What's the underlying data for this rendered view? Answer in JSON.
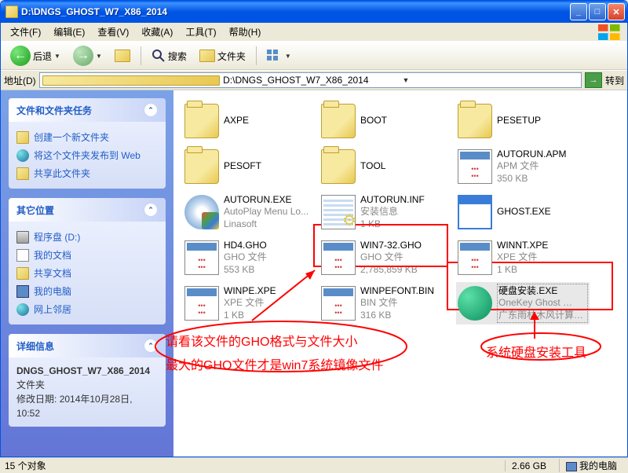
{
  "window": {
    "title": "D:\\DNGS_GHOST_W7_X86_2014"
  },
  "menubar": {
    "file": "文件(F)",
    "edit": "编辑(E)",
    "view": "查看(V)",
    "fav": "收藏(A)",
    "tools": "工具(T)",
    "help": "帮助(H)"
  },
  "toolbar": {
    "back": "后退",
    "search": "搜索",
    "folders": "文件夹"
  },
  "addressbar": {
    "label": "地址(D)",
    "path": "D:\\DNGS_GHOST_W7_X86_2014",
    "go": "转到"
  },
  "sidebar": {
    "tasks_title": "文件和文件夹任务",
    "tasks": {
      "new_folder": "创建一个新文件夹",
      "publish": "将这个文件夹发布到 Web",
      "share": "共享此文件夹"
    },
    "other_title": "其它位置",
    "other": {
      "disk": "程序盘 (D:)",
      "mydocs": "我的文档",
      "shared": "共享文档",
      "mycomp": "我的电脑",
      "network": "网上邻居"
    },
    "details_title": "详细信息",
    "details": {
      "name": "DNGS_GHOST_W7_X86_2014",
      "type": "文件夹",
      "mod_label": "修改日期:",
      "mod_value": "2014年10月28日, 10:52"
    }
  },
  "files": [
    {
      "name": "AXPE",
      "type": "",
      "size": "",
      "icon": "folder"
    },
    {
      "name": "BOOT",
      "type": "",
      "size": "",
      "icon": "folder"
    },
    {
      "name": "PESETUP",
      "type": "",
      "size": "",
      "icon": "folder"
    },
    {
      "name": "PESOFT",
      "type": "",
      "size": "",
      "icon": "folder"
    },
    {
      "name": "TOOL",
      "type": "",
      "size": "",
      "icon": "folder"
    },
    {
      "name": "AUTORUN.APM",
      "type": "APM 文件",
      "size": "350 KB",
      "icon": "doc"
    },
    {
      "name": "AUTORUN.EXE",
      "type": "AutoPlay Menu Lo...",
      "size": "Linasoft",
      "icon": "exe-cd"
    },
    {
      "name": "AUTORUN.INF",
      "type": "安装信息",
      "size": "1 KB",
      "icon": "inf"
    },
    {
      "name": "GHOST.EXE",
      "type": "",
      "size": "",
      "icon": "exe-win"
    },
    {
      "name": "HD4.GHO",
      "type": "GHO 文件",
      "size": "553 KB",
      "icon": "doc"
    },
    {
      "name": "WIN7-32.GHO",
      "type": "GHO 文件",
      "size": "2,785,859 KB",
      "icon": "doc"
    },
    {
      "name": "WINNT.XPE",
      "type": "XPE 文件",
      "size": "1 KB",
      "icon": "doc"
    },
    {
      "name": "WINPE.XPE",
      "type": "XPE 文件",
      "size": "1 KB",
      "icon": "doc"
    },
    {
      "name": "WINPEFONT.BIN",
      "type": "BIN 文件",
      "size": "316 KB",
      "icon": "doc"
    },
    {
      "name": "硬盘安装.EXE",
      "type": "OneKey Ghost …",
      "size": "广东雨林木风计算…",
      "icon": "exe-inst",
      "selected": true
    }
  ],
  "annotations": {
    "line1": "请看该文件的GHO格式与文件大小",
    "line2": "最大的GHO文件才是win7系统镜像文件",
    "line3": "系统硬盘安装工具"
  },
  "statusbar": {
    "count": "15 个对象",
    "size": "2.66 GB",
    "location": "我的电脑"
  }
}
